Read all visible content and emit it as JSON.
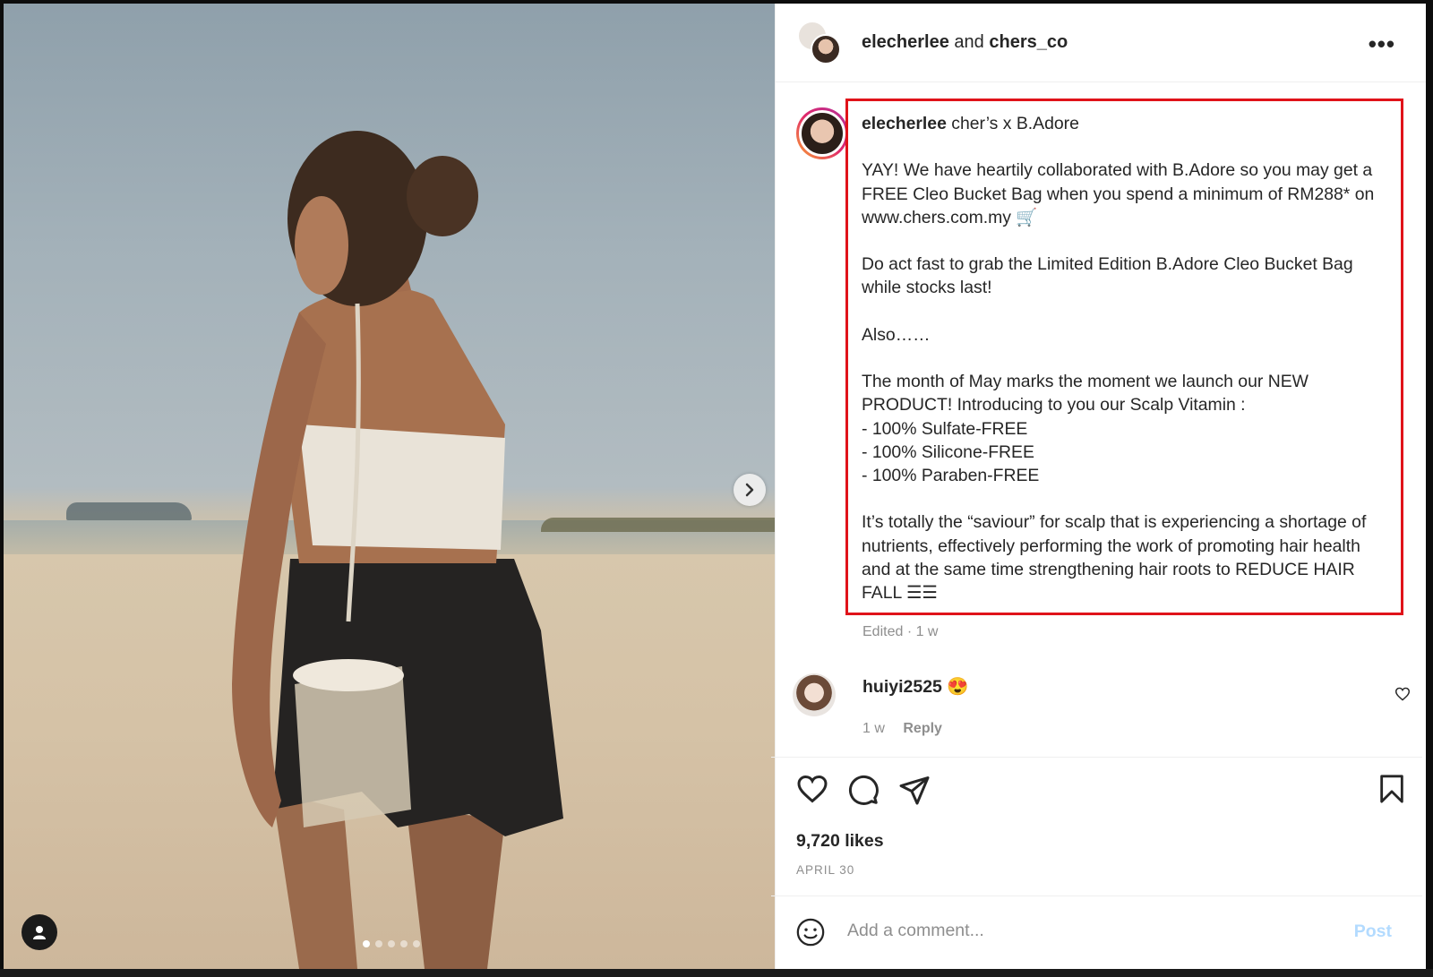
{
  "header": {
    "user1": "elecherlee",
    "joiner": "and",
    "user2": "chers_co",
    "more_label": "•••"
  },
  "caption": {
    "username": "elecherlee",
    "text": "cher’s x B.Adore\n\nYAY! We have heartily collaborated with B.Adore so you may get a FREE Cleo Bucket Bag when you spend a minimum of RM288* on www.chers.com.my 🛒\n\nDo act fast to grab the Limited Edition B.Adore Cleo Bucket Bag while stocks last!\n\nAlso……\n\nThe month of May marks the moment we launch our NEW PRODUCT! Introducing to you our Scalp Vitamin :\n- 100% Sulfate-FREE\n- 100% Silicone-FREE\n- 100% Paraben-FREE\n\nIt’s totally the “saviour” for scalp that is experiencing a shortage of nutrients, effectively performing the work of promoting hair health and at the same time strengthening hair roots to REDUCE HAIR FALL ☰☰",
    "edited": "Edited · 1 w",
    "highlight_color": "#e0131a"
  },
  "comment": {
    "username": "huiyi2525",
    "emoji": "😍",
    "time": "1 w",
    "reply_label": "Reply"
  },
  "stats": {
    "likes": "9,720 likes",
    "date": "APRIL 30"
  },
  "comment_bar": {
    "placeholder": "Add a comment...",
    "post_label": "Post"
  },
  "carousel": {
    "dot_count": 5,
    "active_index": 0
  },
  "icons": {
    "next": "chevron-right-icon",
    "tag": "user-tag-icon",
    "like": "heart-icon",
    "comment": "comment-bubble-icon",
    "share": "paper-plane-icon",
    "save": "bookmark-icon",
    "emoji": "smiley-icon"
  }
}
